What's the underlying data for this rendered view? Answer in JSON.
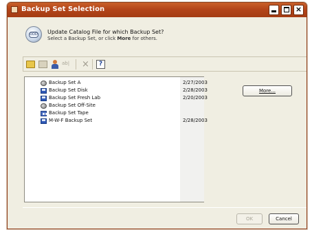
{
  "window": {
    "title": "Backup Set Selection"
  },
  "titlebar_buttons": {
    "minimize": "minimize",
    "maximize": "maximize",
    "close": "×"
  },
  "header": {
    "line1": "Update Catalog File for which Backup Set?",
    "line2_prefix": "Select a Backup Set, or click ",
    "line2_bold": "More",
    "line2_suffix": " for others."
  },
  "toolbar": {
    "rename_label": "ab|",
    "delete_label": "×",
    "help_label": "?"
  },
  "backup_sets": [
    {
      "name": "Backup Set A",
      "date": "2/27/2003",
      "icon": "network-icon"
    },
    {
      "name": "Backup Set Disk",
      "date": "2/28/2003",
      "icon": "disk-icon"
    },
    {
      "name": "Backup Set Fresh Lab",
      "date": "2/20/2003",
      "icon": "disk-icon"
    },
    {
      "name": "Backup Set Off-Site",
      "date": "",
      "icon": "network-icon"
    },
    {
      "name": "Backup Set Tape",
      "date": "",
      "icon": "tape-icon"
    },
    {
      "name": "M-W-F Backup Set",
      "date": "2/28/2003",
      "icon": "disk-icon"
    }
  ],
  "buttons": {
    "more": "More...",
    "ok": "OK",
    "cancel": "Cancel"
  },
  "colors": {
    "titlebar": "#b3451a",
    "dialog_bg": "#f0eee2"
  }
}
